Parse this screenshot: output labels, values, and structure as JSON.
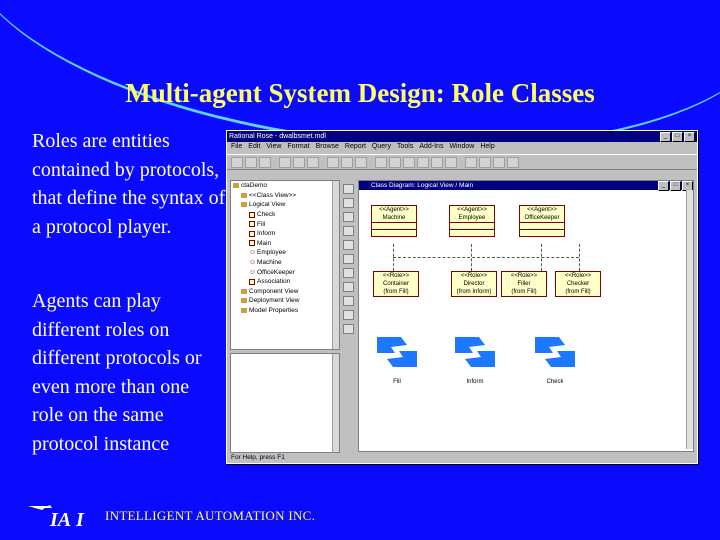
{
  "slide": {
    "title": "Multi-agent System Design: Role Classes",
    "para1": "Roles are entities contained by protocols, that define the syntax of a protocol player.",
    "para2": "Agents can play different roles on different protocols or even more than one role on the same protocol instance",
    "company": "INTELLIGENT AUTOMATION INC."
  },
  "window": {
    "title": "Rational Rose - dwalbsmet.mdl",
    "menus": [
      "File",
      "Edit",
      "View",
      "Format",
      "Browse",
      "Report",
      "Query",
      "Tools",
      "Add-Ins",
      "Window",
      "Help"
    ],
    "browser_items": [
      {
        "label": "ctaDemo",
        "type": "folder"
      },
      {
        "label": "<<Class View>>",
        "type": "folder"
      },
      {
        "label": "Logical View",
        "type": "folder"
      },
      {
        "label": "Check",
        "type": "cls"
      },
      {
        "label": "Fill",
        "type": "cls"
      },
      {
        "label": "Inform",
        "type": "cls"
      },
      {
        "label": "Main",
        "type": "cls"
      },
      {
        "label": "Employee",
        "type": "actor"
      },
      {
        "label": "Machine",
        "type": "actor"
      },
      {
        "label": "OfficeKeeper",
        "type": "actor"
      },
      {
        "label": "Association",
        "type": "cls"
      },
      {
        "label": "Component View",
        "type": "folder"
      },
      {
        "label": "Deployment View",
        "type": "folder"
      },
      {
        "label": "Model Properties",
        "type": "folder"
      }
    ],
    "status": "For Help, press F1",
    "diagram": {
      "title": "Class Diagram: Logical View / Main",
      "agents": [
        {
          "stereo": "<<Agent>>",
          "name": "Machine"
        },
        {
          "stereo": "<<Agent>>",
          "name": "Employee"
        },
        {
          "stereo": "<<Agent>>",
          "name": "OfficeKeeper"
        }
      ],
      "roles": [
        {
          "stereo": "<<Role>>",
          "name": "Container",
          "from": "(from Fill)"
        },
        {
          "stereo": "<<Role>>",
          "name": "Director",
          "from": "(from Inform)"
        },
        {
          "stereo": "<<Role>>",
          "name": "Filler",
          "from": "(from Fill)"
        },
        {
          "stereo": "<<Role>>",
          "name": "Checker",
          "from": "(from Fill)"
        }
      ],
      "protocols": [
        "Fill",
        "Inform",
        "Check"
      ]
    }
  },
  "colors": {
    "background": "#0a0aff",
    "title": "#ffff66",
    "text": "#ffffff",
    "arc": "#5fd3ff",
    "protocol": "#1e78ff"
  }
}
